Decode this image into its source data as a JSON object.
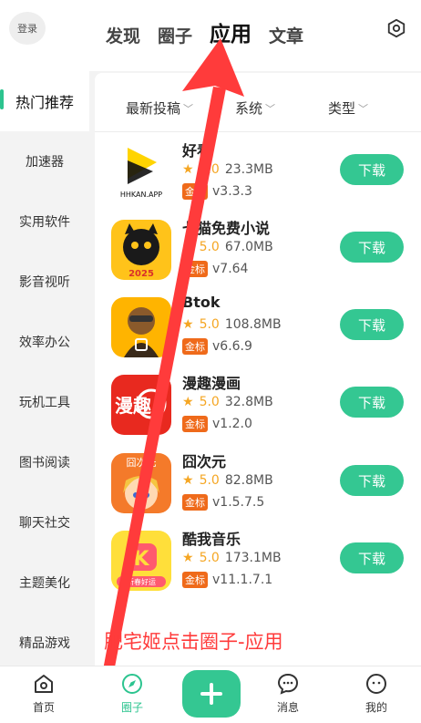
{
  "header": {
    "login_label": "登录",
    "tabs": [
      {
        "label": "发现"
      },
      {
        "label": "圈子"
      },
      {
        "label": "应用"
      },
      {
        "label": "文章"
      }
    ]
  },
  "sidebar": {
    "items": [
      {
        "label": "热门推荐"
      },
      {
        "label": "加速器"
      },
      {
        "label": "实用软件"
      },
      {
        "label": "影音视听"
      },
      {
        "label": "效率办公"
      },
      {
        "label": "玩机工具"
      },
      {
        "label": "图书阅读"
      },
      {
        "label": "聊天社交"
      },
      {
        "label": "主题美化"
      },
      {
        "label": "精品游戏"
      }
    ]
  },
  "filters": {
    "latest": "最新投稿",
    "system": "系统",
    "type": "类型"
  },
  "apps": [
    {
      "name": "好看",
      "rating": "5.0",
      "size": "23.3MB",
      "badge": "金标",
      "version": "v3.3.3",
      "icon_text": "HHKAN.APP",
      "download": "下载"
    },
    {
      "name": "七猫免费小说",
      "rating": "5.0",
      "size": "67.0MB",
      "badge": "金标",
      "version": "v7.64",
      "icon_text": "2025",
      "download": "下载"
    },
    {
      "name": "Btok",
      "rating": "5.0",
      "size": "108.8MB",
      "badge": "金标",
      "version": "v6.6.9",
      "icon_text": "",
      "download": "下载"
    },
    {
      "name": "漫趣漫画",
      "rating": "5.0",
      "size": "32.8MB",
      "badge": "金标",
      "version": "v1.2.0",
      "icon_text": "漫趣",
      "download": "下载"
    },
    {
      "name": "囧次元",
      "rating": "5.0",
      "size": "82.8MB",
      "badge": "金标",
      "version": "v1.5.7.5",
      "icon_text": "囧次元",
      "download": "下载"
    },
    {
      "name": "酷我音乐",
      "rating": "5.0",
      "size": "173.1MB",
      "badge": "金标",
      "version": "v11.1.7.1",
      "icon_text": "新春好运",
      "download": "下载"
    }
  ],
  "overlay": {
    "caption": "肥宅姬点击圈子-应用",
    "color": "#ff3b3b"
  },
  "bottom_nav": {
    "home": "首页",
    "circle": "圈子",
    "messages": "消息",
    "mine": "我的"
  },
  "colors": {
    "accent": "#34c792",
    "star": "#f5a623",
    "badge": "#ef6a1a"
  }
}
